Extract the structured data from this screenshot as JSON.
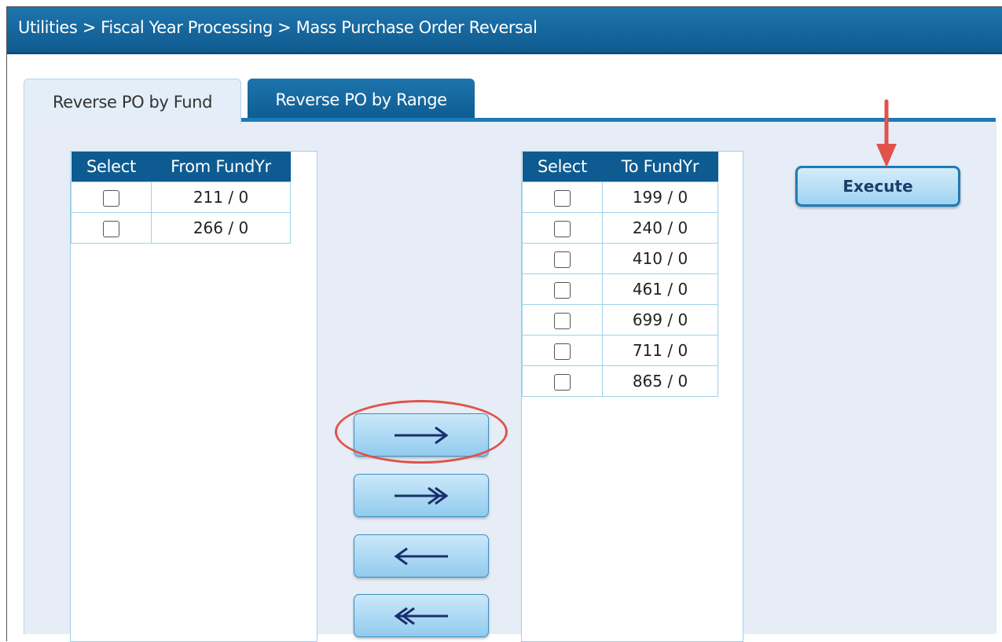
{
  "breadcrumb": "Utilities > Fiscal Year Processing > Mass Purchase Order Reversal",
  "tabs": [
    {
      "label": "Reverse PO by Fund",
      "active": true
    },
    {
      "label": "Reverse PO by Range",
      "active": false
    }
  ],
  "from_list": {
    "headers": [
      "Select",
      "From FundYr"
    ],
    "rows": [
      {
        "value": "211 / 0",
        "checked": false
      },
      {
        "value": "266 / 0",
        "checked": false
      }
    ]
  },
  "to_list": {
    "headers": [
      "Select",
      "To FundYr"
    ],
    "rows": [
      {
        "value": "199 / 0",
        "checked": false
      },
      {
        "value": "240 / 0",
        "checked": false
      },
      {
        "value": "410 / 0",
        "checked": false
      },
      {
        "value": "461 / 0",
        "checked": false
      },
      {
        "value": "699 / 0",
        "checked": false
      },
      {
        "value": "711 / 0",
        "checked": false
      },
      {
        "value": "865 / 0",
        "checked": false
      }
    ]
  },
  "buttons": {
    "execute_label": "Execute",
    "move_icons": [
      "arrow-right-icon",
      "double-arrow-right-icon",
      "arrow-left-icon",
      "double-arrow-left-icon"
    ]
  },
  "colors": {
    "header_blue": "#0d5b91",
    "panel_bg": "#e6edf6",
    "annotation_red": "#e0524a"
  }
}
